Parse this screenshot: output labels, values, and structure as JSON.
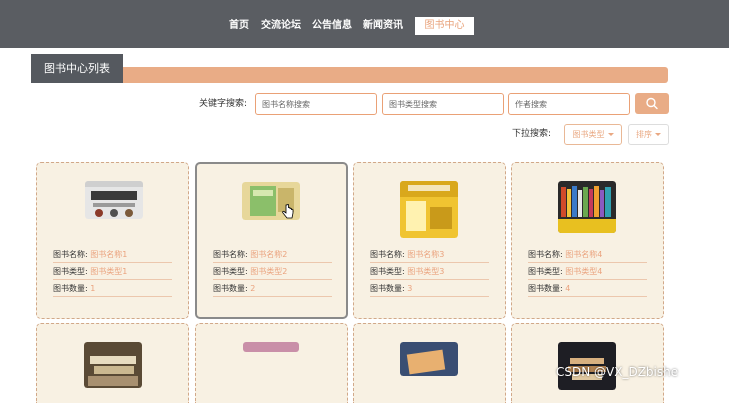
{
  "nav": {
    "items": [
      {
        "label": "首页"
      },
      {
        "label": "交流论坛"
      },
      {
        "label": "公告信息"
      },
      {
        "label": "新闻资讯"
      },
      {
        "label": "图书中心"
      }
    ]
  },
  "page_title": "图书中心列表",
  "search": {
    "keyword_label": "关键字搜索:",
    "name_placeholder": "图书名称搜索",
    "type_placeholder": "图书类型搜索",
    "author_placeholder": "作者搜索"
  },
  "dropdowns": {
    "label": "下拉搜索:",
    "type_label": "图书类型",
    "sort_label": "排序"
  },
  "field_labels": {
    "name": "图书名称:",
    "type": "图书类型:",
    "count": "图书数量:"
  },
  "books": [
    {
      "name": "图书名称1",
      "type": "图书类型1",
      "count": "1",
      "cover_icon": "book-cover-sanguo"
    },
    {
      "name": "图书名称2",
      "type": "图书类型2",
      "count": "2",
      "cover_icon": "book-cover-green"
    },
    {
      "name": "图书名称3",
      "type": "图书类型3",
      "count": "3",
      "cover_icon": "book-cover-yellow"
    },
    {
      "name": "图书名称4",
      "type": "图书类型4",
      "count": "4",
      "cover_icon": "book-cover-shelf"
    }
  ],
  "colors": {
    "header_bg": "#5a5d62",
    "accent": "#e9ac86",
    "card_bg": "#f8f1e3",
    "value_text": "#eaa27d"
  },
  "watermark": "CSDN @VX_DZbishe"
}
